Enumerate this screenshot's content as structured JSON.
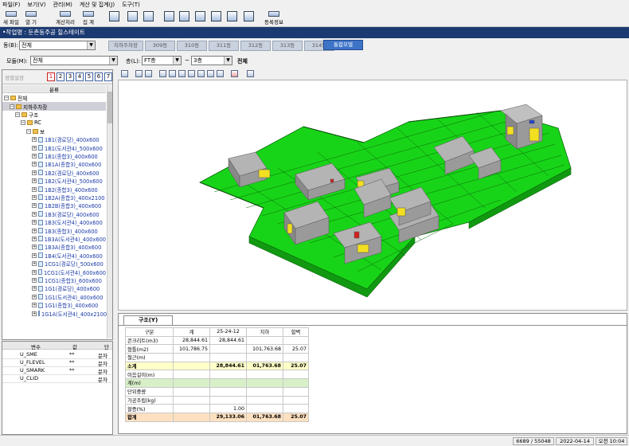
{
  "menu": [
    "파일(F)",
    "보기(V)",
    "관리(M)",
    "계산 및 집계(J)",
    "도구(T)"
  ],
  "toolbar": {
    "new": "새 파일",
    "open": "열 기",
    "calc": "계산처리",
    "aggregate": "집 계",
    "register": "등록정보"
  },
  "title": "•작업명 : 둔촌동주공 힐스테이트",
  "building_label": "동(B):",
  "building_value": "전체",
  "building_tabs": [
    "지하주차장",
    "309동",
    "310동",
    "311동",
    "312동",
    "313동",
    "314동",
    "통합모델"
  ],
  "active_tab": "통합모델",
  "member_label": "모듈(M):",
  "member_value": "전체",
  "floor_label": "층(L):",
  "floor_from": "FT층",
  "floor_sep": "~",
  "floor_to": "3층",
  "floor_all": "전체",
  "tree_tools": {
    "sort_label": "정렬설정",
    "levels": [
      "1",
      "2",
      "3",
      "4",
      "5",
      "6",
      "7"
    ]
  },
  "tree_header": "분류",
  "tree": [
    {
      "label": "전체",
      "depth": 0,
      "type": "folder"
    },
    {
      "label": "지하주차장",
      "depth": 1,
      "type": "folder",
      "selected": true
    },
    {
      "label": "구조",
      "depth": 2,
      "type": "folder"
    },
    {
      "label": "RC",
      "depth": 3,
      "type": "folder"
    },
    {
      "label": "보",
      "depth": 4,
      "type": "folder"
    },
    {
      "label": "1B1(경로당)_400x600",
      "depth": 5,
      "type": "doc"
    },
    {
      "label": "1B1(도서관4)_500x600",
      "depth": 5,
      "type": "doc"
    },
    {
      "label": "1B1(종합3)_400x600",
      "depth": 5,
      "type": "doc"
    },
    {
      "label": "1B1A(종합3)_400x600",
      "depth": 5,
      "type": "doc"
    },
    {
      "label": "1B2(경로당)_400x600",
      "depth": 5,
      "type": "doc"
    },
    {
      "label": "1B2(도서관4)_500x600",
      "depth": 5,
      "type": "doc"
    },
    {
      "label": "1B2(종합3)_400x600",
      "depth": 5,
      "type": "doc"
    },
    {
      "label": "1B2A(종합3)_400x2100",
      "depth": 5,
      "type": "doc"
    },
    {
      "label": "1B2B(종합3)_400x600",
      "depth": 5,
      "type": "doc"
    },
    {
      "label": "1B3(경로당)_400x600",
      "depth": 5,
      "type": "doc"
    },
    {
      "label": "1B3(도서관4)_400x600",
      "depth": 5,
      "type": "doc"
    },
    {
      "label": "1B3(종합3)_400x600",
      "depth": 5,
      "type": "doc"
    },
    {
      "label": "1B3A(도서관4)_400x600",
      "depth": 5,
      "type": "doc"
    },
    {
      "label": "1B3A(종합3)_400x600",
      "depth": 5,
      "type": "doc"
    },
    {
      "label": "1B4(도서관4)_400x600",
      "depth": 5,
      "type": "doc"
    },
    {
      "label": "1CG1(경로당)_500x600",
      "depth": 5,
      "type": "doc"
    },
    {
      "label": "1CG1(도서관4)_600x600",
      "depth": 5,
      "type": "doc"
    },
    {
      "label": "1CG1(종합3)_600x600",
      "depth": 5,
      "type": "doc"
    },
    {
      "label": "1G1(경로당)_400x600",
      "depth": 5,
      "type": "doc"
    },
    {
      "label": "1G1(도서관4)_400x600",
      "depth": 5,
      "type": "doc"
    },
    {
      "label": "1G1(종합3)_400x600",
      "depth": 5,
      "type": "doc"
    },
    {
      "label": "1G1A(도서관4)_400x2100",
      "depth": 5,
      "type": "doc"
    }
  ],
  "props": {
    "headers": [
      "변수",
      "값",
      "단"
    ],
    "rows": [
      {
        "name": "U_SME",
        "val": "**",
        "unit": "문자"
      },
      {
        "name": "U_FLEVEL",
        "val": "**",
        "unit": "문자"
      },
      {
        "name": "U_SMARK",
        "val": "**",
        "unit": "문자"
      },
      {
        "name": "U_CLID",
        "val": "",
        "unit": "문자"
      }
    ]
  },
  "bottom_tab": "구조(Y)",
  "table": {
    "headers": [
      "구분",
      "계",
      "25-24-12",
      "지하",
      "합벽"
    ],
    "rows": [
      {
        "cells": [
          "콘크리트(m3)",
          "28,844.61",
          "28,844.61",
          "",
          ""
        ],
        "style": ""
      },
      {
        "cells": [
          "형틀(m2)",
          "101,786.75",
          "",
          "101,763.68",
          "25.07"
        ],
        "style": ""
      },
      {
        "cells": [
          "철근(m)",
          "",
          "",
          "",
          ""
        ],
        "style": ""
      },
      {
        "cells": [
          "소계",
          "",
          "28,844.61",
          "01,763.68",
          "25.07"
        ],
        "style": "yel"
      },
      {
        "cells": [
          "이음길이(m)",
          "",
          "",
          "",
          ""
        ],
        "style": ""
      },
      {
        "cells": [
          "계(m)",
          "",
          "",
          "",
          ""
        ],
        "style": "grn"
      },
      {
        "cells": [
          "단위중량",
          "",
          "",
          "",
          ""
        ],
        "style": ""
      },
      {
        "cells": [
          "가공조립(kg)",
          "",
          "",
          "",
          ""
        ],
        "style": ""
      },
      {
        "cells": [
          "할증(%)",
          "",
          "1.00",
          "",
          ""
        ],
        "style": ""
      },
      {
        "cells": [
          "합계",
          "",
          "29,133.06",
          "01,763.68",
          "25.07"
        ],
        "style": "org"
      }
    ]
  },
  "status": {
    "count": "6689 / 55048",
    "date": "2022-04-14",
    "time": "오전 10:04"
  },
  "colors": {
    "title_bg": "#1c3a72",
    "active_tab": "#3e74c8",
    "model_green": "#22dd22",
    "building_gray": "#a8a8a8",
    "yellow_row": "#ffffc8",
    "orange_row": "#fde0c0"
  }
}
